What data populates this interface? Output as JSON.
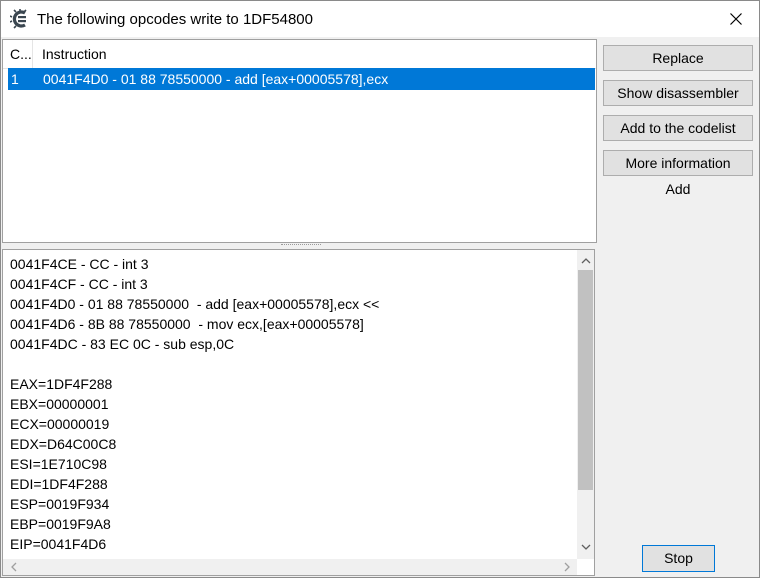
{
  "window": {
    "title": "The following opcodes write to 1DF54800",
    "icon": "cheat-engine-icon",
    "close_icon": "close-icon"
  },
  "listview": {
    "columns": [
      "C...",
      "Instruction"
    ],
    "rows": [
      {
        "count": "1",
        "instruction": "0041F4D0 - 01 88 78550000  - add [eax+00005578],ecx",
        "selected": true
      }
    ]
  },
  "buttons": {
    "replace": "Replace",
    "show_disassembler": "Show disassembler",
    "add_to_codelist": "Add to the codelist",
    "more_information": "More information",
    "stop": "Stop"
  },
  "add_label": "Add",
  "memo": {
    "lines": [
      "0041F4CE - CC - int 3",
      "0041F4CF - CC - int 3",
      "0041F4D0 - 01 88 78550000  - add [eax+00005578],ecx <<",
      "0041F4D6 - 8B 88 78550000  - mov ecx,[eax+00005578]",
      "0041F4DC - 83 EC 0C - sub esp,0C",
      "",
      "EAX=1DF4F288",
      "EBX=00000001",
      "ECX=00000019",
      "EDX=D64C00C8",
      "ESI=1E710C98",
      "EDI=1DF4F288",
      "ESP=0019F934",
      "EBP=0019F9A8",
      "EIP=0041F4D6"
    ]
  },
  "colors": {
    "selection": "#0078d7",
    "window_bg": "#f0f0f0",
    "button_bg": "#e1e1e1"
  }
}
